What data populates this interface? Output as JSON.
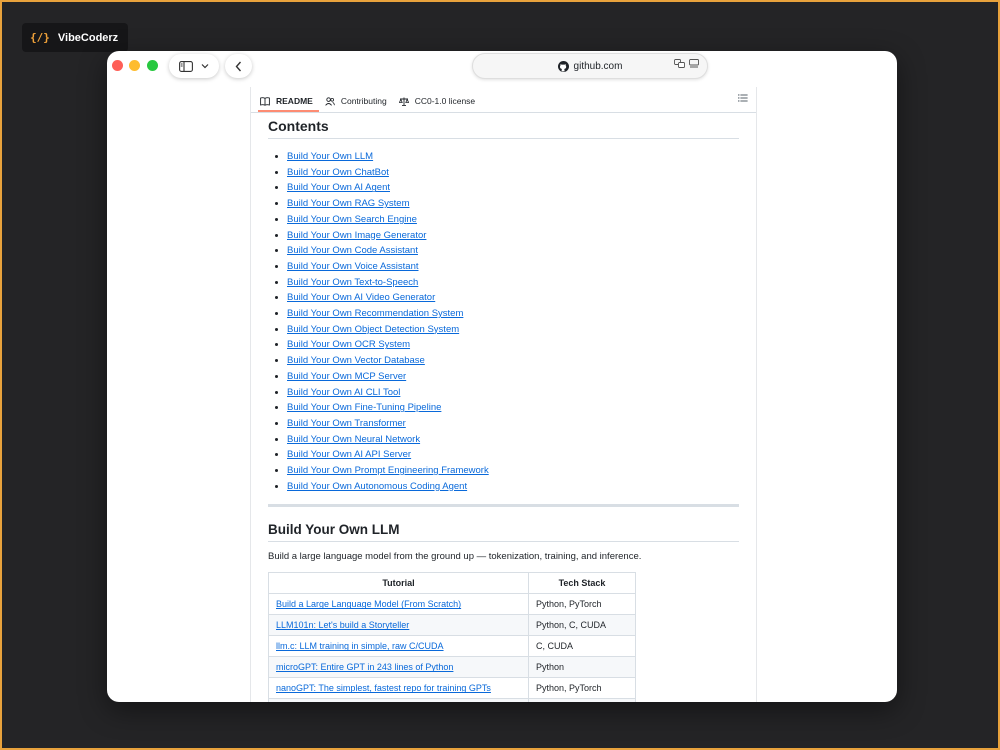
{
  "badge": {
    "logo": "{/}",
    "label": "VibeCoderz"
  },
  "browser": {
    "url": "github.com"
  },
  "tabs": [
    {
      "label": "README",
      "icon": "book-icon"
    },
    {
      "label": "Contributing",
      "icon": "people-icon"
    },
    {
      "label": "CC0-1.0 license",
      "icon": "scale-icon"
    }
  ],
  "contents": {
    "heading": "Contents",
    "items": [
      "Build Your Own LLM",
      "Build Your Own ChatBot",
      "Build Your Own AI Agent",
      "Build Your Own RAG System",
      "Build Your Own Search Engine",
      "Build Your Own Image Generator",
      "Build Your Own Code Assistant",
      "Build Your Own Voice Assistant",
      "Build Your Own Text-to-Speech",
      "Build Your Own AI Video Generator",
      "Build Your Own Recommendation System",
      "Build Your Own Object Detection System",
      "Build Your Own OCR System",
      "Build Your Own Vector Database",
      "Build Your Own MCP Server",
      "Build Your Own AI CLI Tool",
      "Build Your Own Fine-Tuning Pipeline",
      "Build Your Own Transformer",
      "Build Your Own Neural Network",
      "Build Your Own AI API Server",
      "Build Your Own Prompt Engineering Framework",
      "Build Your Own Autonomous Coding Agent"
    ]
  },
  "section": {
    "heading": "Build Your Own LLM",
    "description": "Build a large language model from the ground up — tokenization, training, and inference.",
    "table": {
      "headers": [
        "Tutorial",
        "Tech Stack"
      ],
      "rows": [
        {
          "tutorial": "Build a Large Language Model (From Scratch)",
          "stack": "Python, PyTorch"
        },
        {
          "tutorial": "LLM101n: Let's build a Storyteller",
          "stack": "Python, C, CUDA"
        },
        {
          "tutorial": "llm.c: LLM training in simple, raw C/CUDA",
          "stack": "C, CUDA"
        },
        {
          "tutorial": "microGPT: Entire GPT in 243 lines of Python",
          "stack": "Python"
        },
        {
          "tutorial": "nanoGPT: The simplest, fastest repo for training GPTs",
          "stack": "Python, PyTorch"
        }
      ]
    }
  }
}
